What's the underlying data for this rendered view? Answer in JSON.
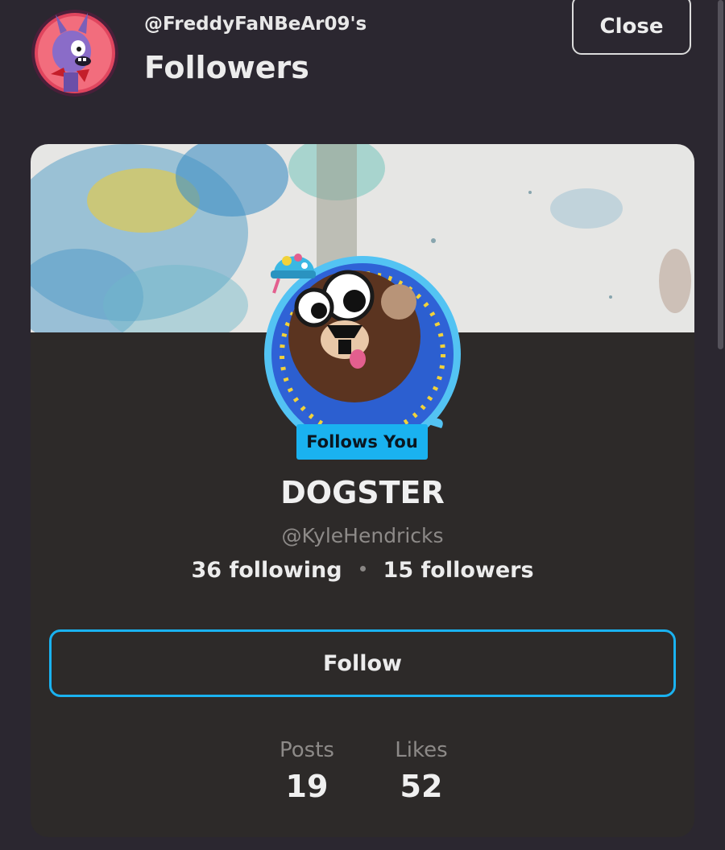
{
  "header": {
    "subtitle": "@FreddyFaNBeAr09's",
    "title": "Followers",
    "close_label": "Close",
    "avatar_icon": "purple-bunny-character-avatar"
  },
  "profile": {
    "badge": "Follows You",
    "display_name": "DOGSTER",
    "username": "@KyleHendricks",
    "following": "36 following",
    "followers": "15 followers",
    "follow_label": "Follow",
    "banner_icon": "watercolor-banner-image",
    "avatar_icon": "brown-dog-with-party-hat-avatar"
  },
  "metrics": [
    {
      "label": "Posts",
      "value": "19"
    },
    {
      "label": "Likes",
      "value": "52"
    }
  ],
  "colors": {
    "background": "#2b2730",
    "card": "#2d2a29",
    "accent": "#1ab2f0"
  }
}
